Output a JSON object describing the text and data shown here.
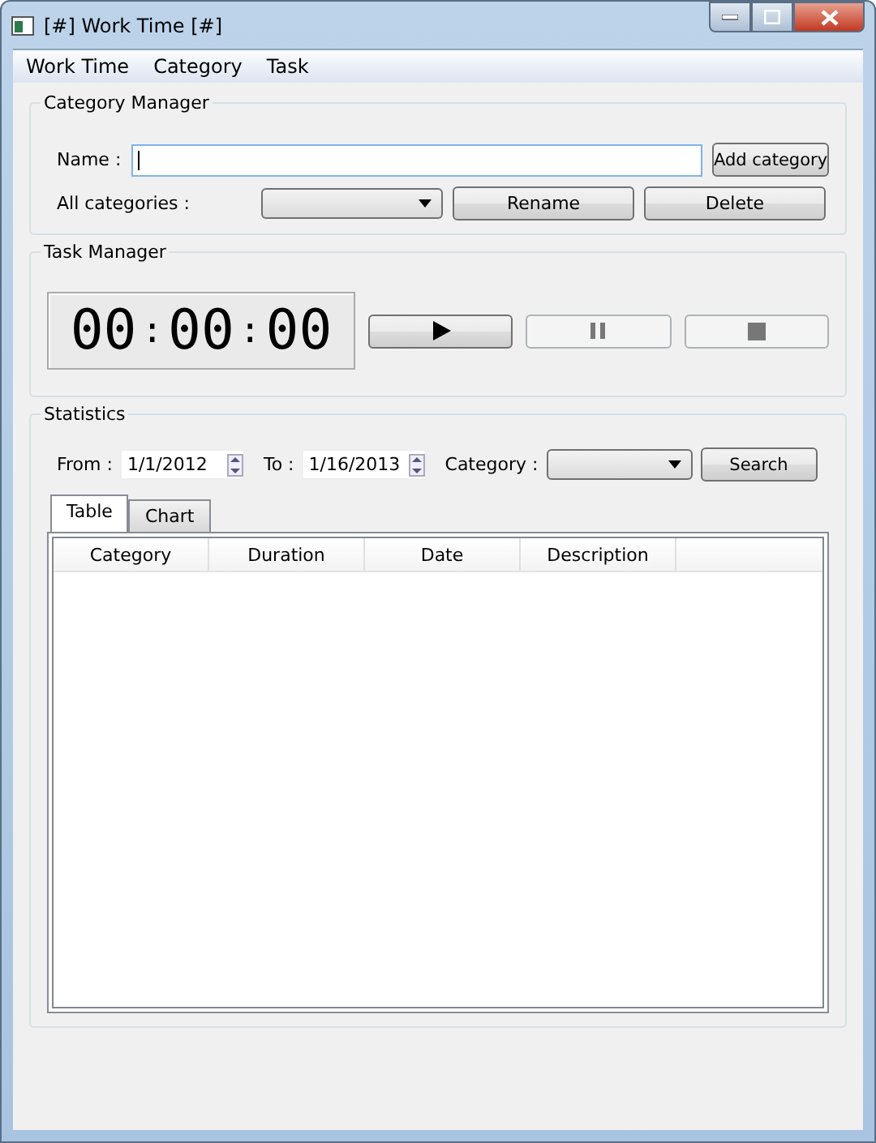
{
  "window": {
    "title": "[#] Work Time [#]"
  },
  "menu": [
    "Work Time",
    "Category",
    "Task"
  ],
  "category_manager": {
    "title": "Category Manager",
    "name_label": "Name :",
    "add_button": "Add category",
    "all_label": "All categories :",
    "rename_button": "Rename",
    "delete_button": "Delete"
  },
  "task_manager": {
    "title": "Task Manager",
    "timer": [
      "00",
      "00",
      "00"
    ],
    "separators": [
      ":",
      ":"
    ],
    "controls": [
      {
        "kind": "play",
        "disabled": false
      },
      {
        "kind": "pause",
        "disabled": true
      },
      {
        "kind": "stop",
        "disabled": true
      }
    ]
  },
  "statistics": {
    "title": "Statistics",
    "from_label": "From :",
    "from_value": "1/1/2012",
    "to_label": "To :",
    "to_value": "1/16/2013",
    "category_label": "Category :",
    "search_button": "Search",
    "tabs": [
      {
        "label": "Table",
        "selected": true
      },
      {
        "label": "Chart",
        "selected": false
      }
    ],
    "table": {
      "columns": [
        "Category",
        "Duration",
        "Date",
        "Description"
      ]
    }
  }
}
